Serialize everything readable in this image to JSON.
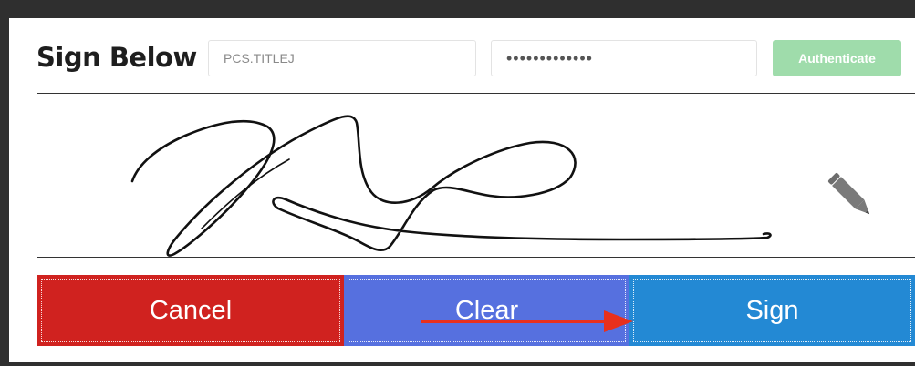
{
  "header": {
    "title": "Sign Below",
    "username_value": "PCS.TITLEJ",
    "password_value": "•••••••••••••",
    "authenticate_label": "Authenticate"
  },
  "signature_pad": {
    "pen_icon": "pencil-icon"
  },
  "actions": {
    "cancel_label": "Cancel",
    "clear_label": "Clear",
    "sign_label": "Sign"
  },
  "colors": {
    "cancel": "#d0221f",
    "clear": "#5670df",
    "sign": "#2389d4",
    "authenticate": "#9fdcab",
    "annotation_arrow": "#e8301c"
  }
}
